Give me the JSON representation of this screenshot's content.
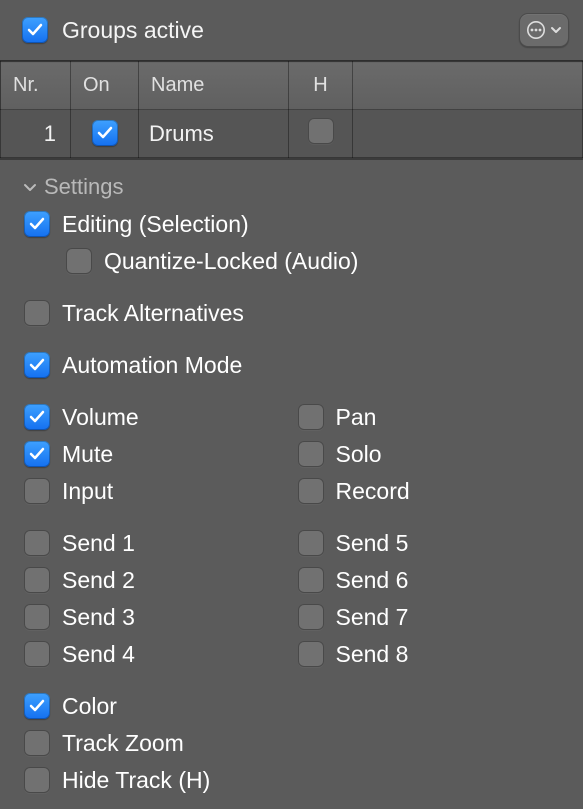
{
  "header": {
    "groups_active_label": "Groups active",
    "groups_active_checked": true
  },
  "table": {
    "columns": [
      "Nr.",
      "On",
      "Name",
      "H",
      ""
    ],
    "rows": [
      {
        "nr": "1",
        "on": true,
        "name": "Drums",
        "h": false
      }
    ]
  },
  "settings": {
    "heading": "Settings",
    "editing": {
      "label": "Editing (Selection)",
      "checked": true
    },
    "quantize_locked": {
      "label": "Quantize-Locked (Audio)",
      "checked": false
    },
    "track_alternatives": {
      "label": "Track Alternatives",
      "checked": false
    },
    "automation_mode": {
      "label": "Automation Mode",
      "checked": true
    },
    "col_a1": [
      {
        "key": "volume",
        "label": "Volume",
        "checked": true
      },
      {
        "key": "mute",
        "label": "Mute",
        "checked": true
      },
      {
        "key": "input",
        "label": "Input",
        "checked": false
      }
    ],
    "col_b1": [
      {
        "key": "pan",
        "label": "Pan",
        "checked": false
      },
      {
        "key": "solo",
        "label": "Solo",
        "checked": false
      },
      {
        "key": "record",
        "label": "Record",
        "checked": false
      }
    ],
    "col_a2": [
      {
        "key": "send1",
        "label": "Send 1",
        "checked": false
      },
      {
        "key": "send2",
        "label": "Send 2",
        "checked": false
      },
      {
        "key": "send3",
        "label": "Send 3",
        "checked": false
      },
      {
        "key": "send4",
        "label": "Send 4",
        "checked": false
      }
    ],
    "col_b2": [
      {
        "key": "send5",
        "label": "Send 5",
        "checked": false
      },
      {
        "key": "send6",
        "label": "Send 6",
        "checked": false
      },
      {
        "key": "send7",
        "label": "Send 7",
        "checked": false
      },
      {
        "key": "send8",
        "label": "Send 8",
        "checked": false
      }
    ],
    "color": {
      "label": "Color",
      "checked": true
    },
    "track_zoom": {
      "label": "Track Zoom",
      "checked": false
    },
    "hide_track": {
      "label": "Hide Track (H)",
      "checked": false
    }
  }
}
